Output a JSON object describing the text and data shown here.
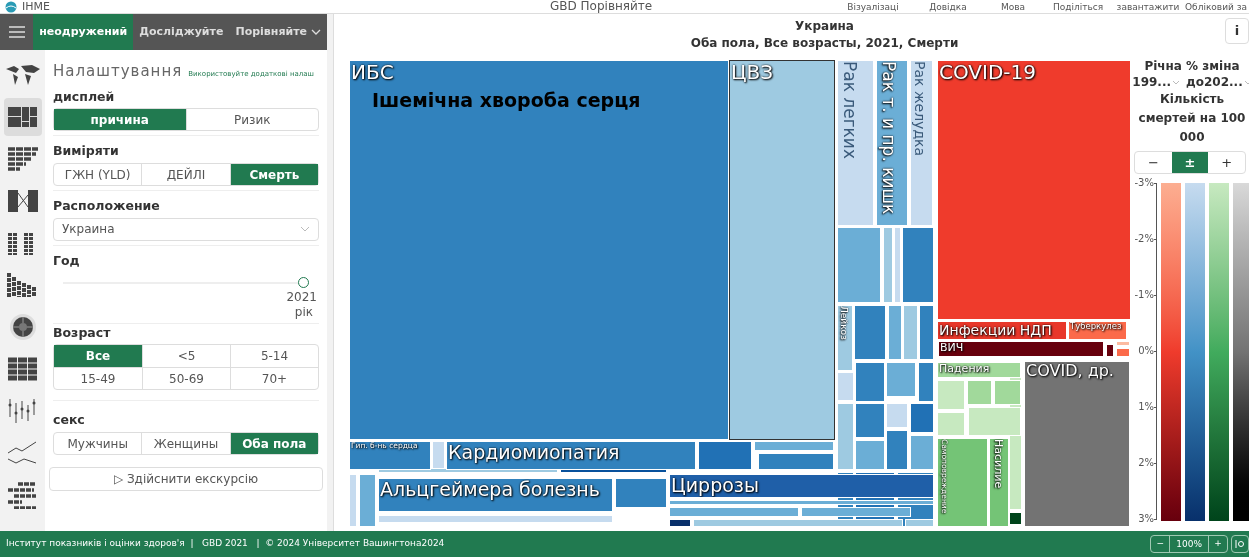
{
  "header": {
    "logo": "IHME",
    "title": "GBD Порівняйте",
    "links": [
      "Візуалізаці",
      "Довідка",
      "Мова",
      "Поділіться",
      "завантажити",
      "Обліковий за"
    ]
  },
  "nav": {
    "tabs": [
      {
        "label": "неодружений",
        "selected": true
      },
      {
        "label": "Досліджуйте",
        "selected": false
      },
      {
        "label": "Порівняйте",
        "selected": false,
        "dropdown": true
      }
    ]
  },
  "view_icons": [
    {
      "kind": "map",
      "selected": false
    },
    {
      "kind": "treemap",
      "selected": true
    },
    {
      "kind": "stacked",
      "selected": false
    },
    {
      "kind": "arrow",
      "selected": false
    },
    {
      "kind": "pyramid",
      "selected": false
    },
    {
      "kind": "bars",
      "selected": false
    },
    {
      "kind": "sunburst",
      "selected": false
    },
    {
      "kind": "grid",
      "selected": false
    },
    {
      "kind": "dots",
      "selected": false
    },
    {
      "kind": "line",
      "selected": false
    },
    {
      "kind": "bricks",
      "selected": false
    }
  ],
  "settings": {
    "title": "Налаштування",
    "advanced_link": "Використовуйте додаткові налаш",
    "display": {
      "label": "дисплей",
      "options": [
        {
          "label": "причина",
          "selected": true
        },
        {
          "label": "Ризик",
          "selected": false
        }
      ]
    },
    "measure": {
      "label": "Виміряти",
      "options": [
        {
          "label": "ГЖН (YLD)",
          "selected": false
        },
        {
          "label": "ДЕЙЛІ",
          "selected": false
        },
        {
          "label": "Смерть",
          "selected": true
        }
      ]
    },
    "location": {
      "label": "Расположение",
      "value": "Украина"
    },
    "year": {
      "label": "Год",
      "level": 1,
      "value": "2021",
      "unit": "рік"
    },
    "age": {
      "label": "Возраст",
      "options": [
        {
          "label": "Все",
          "selected": true
        },
        {
          "label": "<5",
          "selected": false
        },
        {
          "label": "5-14",
          "selected": false
        },
        {
          "label": "15-49",
          "selected": false
        },
        {
          "label": "50-69",
          "selected": false
        },
        {
          "label": "70+",
          "selected": false
        }
      ]
    },
    "sex": {
      "label": "секс",
      "options": [
        {
          "label": "Мужчины",
          "selected": false
        },
        {
          "label": "Женщины",
          "selected": false
        },
        {
          "label": "Оба пола",
          "selected": true
        }
      ]
    },
    "tour_button": "▷ Здійснити екскурсію"
  },
  "chart": {
    "title": "Украина",
    "subtitle": "Оба пола, Все возрасты, 2021, Смерти",
    "info_button": "i",
    "tiles": [
      {
        "label": "ИБС",
        "color": "#3182bd",
        "hover_label": "Ішемічна хвороба серця",
        "highlighted": false
      },
      {
        "label": "ЦВЗ",
        "color": "#9ecae1",
        "highlighted": true
      },
      {
        "label": "Рак легких",
        "color": "#c6dbef",
        "highlighted": false
      },
      {
        "label": "Рак т. и пр. кишк",
        "color": "#6baed6",
        "highlighted": false
      },
      {
        "label": "Рак желудка",
        "color": "#c6dbef",
        "highlighted": false
      },
      {
        "label": "COVID-19",
        "color": "#ef3b2c",
        "highlighted": false
      },
      {
        "label": "Инфекции НДП",
        "color": "#e8372a",
        "highlighted": false
      },
      {
        "label": "Туберкулез",
        "color": "#fb6a4a",
        "highlighted": false
      },
      {
        "label": "ВИЧ",
        "color": "#67000d",
        "highlighted": false
      },
      {
        "label": "Падения",
        "color": "#a1d99b",
        "highlighted": false
      },
      {
        "label": "Самоповреждение",
        "color": "#74c476",
        "highlighted": false
      },
      {
        "label": "Насилие",
        "color": "#74c476",
        "highlighted": false
      },
      {
        "label": "COVID, др.",
        "color": "#737373",
        "highlighted": false
      },
      {
        "label": "Гип. б-нь сердца",
        "color": "#3182bd",
        "highlighted": false
      },
      {
        "label": "Кардиомиопатия",
        "color": "#3182bd",
        "highlighted": false
      },
      {
        "label": "Альцгеймера болезнь",
        "color": "#3182bd",
        "highlighted": false
      },
      {
        "label": "Циррозы",
        "color": "#1f5fa8",
        "highlighted": false
      },
      {
        "label": "Лейкоз",
        "color": "#9ecae1",
        "highlighted": false
      }
    ]
  },
  "legend": {
    "title": "Річна % зміна",
    "from": "199...",
    "to": "до202...",
    "subtitle": "Кількість смертей на 100 000",
    "modes": [
      {
        "label": "−",
        "selected": false
      },
      {
        "label": "±",
        "selected": true
      },
      {
        "label": "+",
        "selected": false
      }
    ],
    "ticks": [
      "-3%",
      "-2%",
      "-1%",
      "0%",
      "1%",
      "2%",
      "3%"
    ]
  },
  "footer": {
    "text": "Інститут показників і оцінки здоров'я  |   GBD 2021   |  © 2024 Університет Вашингтона2024",
    "zoom": {
      "minus": "−",
      "value": "100%",
      "plus": "+"
    }
  }
}
